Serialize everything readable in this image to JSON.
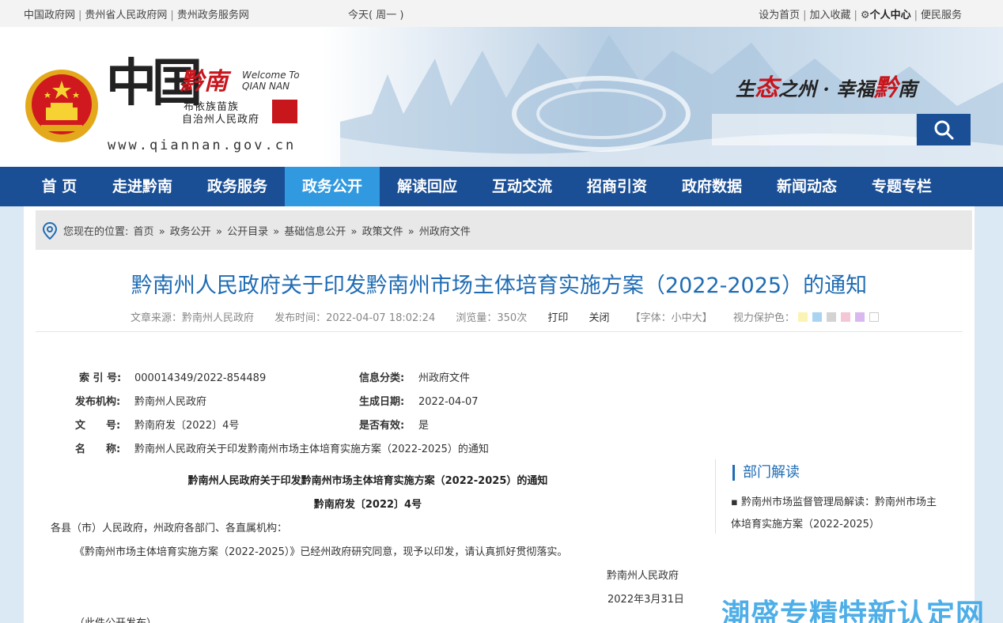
{
  "topbar": {
    "links_left": [
      "中国政府网",
      "贵州省人民政府网",
      "贵州政务服务网"
    ],
    "today": "今天( 周一 )",
    "links_right": [
      "设为首页",
      "加入收藏",
      "个人中心",
      "便民服务"
    ]
  },
  "header": {
    "logo_zhongguo": "中国",
    "logo_qiannan": "黔南",
    "welcome_line1": "Welcome To",
    "welcome_line2": "QIAN NAN",
    "logo_sub1": "布依族苗族",
    "logo_sub2": "自治州人民政府",
    "url": "www.qiannan.gov.cn",
    "slogan_a": "生",
    "slogan_b": "态",
    "slogan_c": "之州 · 幸福",
    "slogan_d": "黔",
    "slogan_e": "南",
    "search_placeholder": ""
  },
  "nav": {
    "items": [
      "首 页",
      "走进黔南",
      "政务服务",
      "政务公开",
      "解读回应",
      "互动交流",
      "招商引资",
      "政府数据",
      "新闻动态",
      "专题专栏"
    ],
    "active_index": 3
  },
  "breadcrumb": {
    "prefix": "您现在的位置:",
    "items": [
      "首页",
      "政务公开",
      "公开目录",
      "基础信息公开",
      "政策文件",
      "州政府文件"
    ],
    "separator": "»"
  },
  "article": {
    "title": "黔南州人民政府关于印发黔南州市场主体培育实施方案（2022-2025）的通知",
    "source": "文章来源：黔南州人民政府",
    "published": "发布时间：2022-04-07 18:02:24",
    "views": "浏览量：350次",
    "print": "打印",
    "close": "关闭",
    "font_size": "【字体：小中大】",
    "eye_protect": "视力保护色："
  },
  "eye_colors": [
    "#fbf3b4",
    "#a8d4f2",
    "#d3d3d3",
    "#f5c6d6",
    "#d9b8f0",
    "#ffffff"
  ],
  "info": {
    "index_no_label": "索 引 号:",
    "index_no": "000014349/2022-854489",
    "category_label": "信息分类:",
    "category": "州政府文件",
    "publisher_label": "发布机构:",
    "publisher": "黔南州人民政府",
    "date_label": "生成日期:",
    "date": "2022-04-07",
    "doc_no_label": "文　　号:",
    "doc_no": "黔南府发〔2022〕4号",
    "valid_label": "是否有效:",
    "valid": "是",
    "name_label": "名　　称:",
    "name": "黔南州人民政府关于印发黔南州市场主体培育实施方案（2022-2025）的通知"
  },
  "doc": {
    "heading": "黔南州人民政府关于印发黔南州市场主体培育实施方案（2022-2025）的通知",
    "number": "黔南府发〔2022〕4号",
    "salutation": "各县（市）人民政府，州政府各部门、各直属机构：",
    "body": "《黔南州市场主体培育实施方案（2022-2025）》已经州政府研究同意，现予以印发，请认真抓好贯彻落实。",
    "signer": "黔南州人民政府",
    "sign_date": "2022年3月31日",
    "footer": "（此件公开发布）"
  },
  "sidebar": {
    "title": "部门解读",
    "link": "黔南州市场监督管理局解读：黔南州市场主体培育实施方案（2022-2025）"
  },
  "watermark": "潮盛专精特新认定网",
  "colors": {
    "nav_bg": "#1a4f96",
    "nav_active": "#3199e0",
    "title_blue": "#1f6cb4",
    "brand_red": "#c8161d"
  }
}
